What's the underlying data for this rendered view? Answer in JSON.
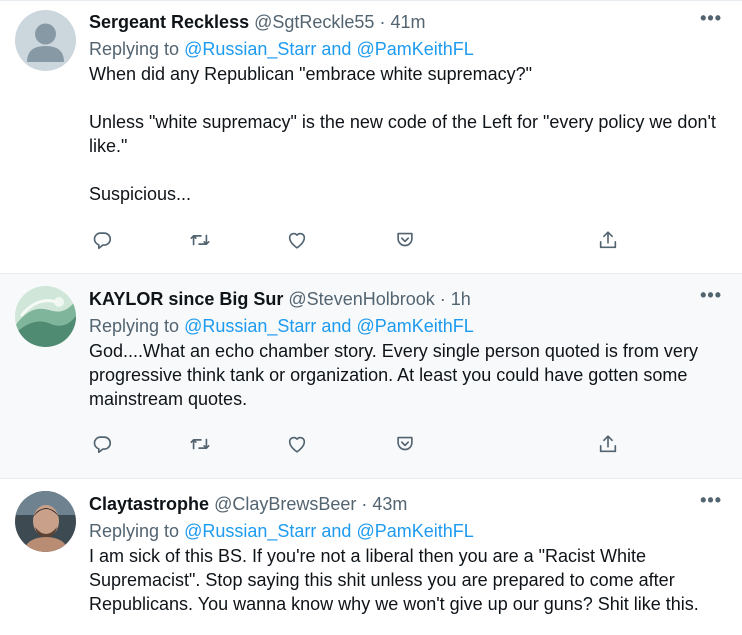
{
  "tweets": [
    {
      "name": "Sergeant Reckless",
      "handle": "@SgtReckle55",
      "dot": "·",
      "time": "41m",
      "more": "•••",
      "replying_prefix": "Replying to ",
      "reply_user_1": "@Russian_Starr",
      "reply_and": " and ",
      "reply_user_2": "@PamKeithFL",
      "paragraphs": [
        "When did any Republican \"embrace white supremacy?\"",
        "Unless \"white supremacy\" is the new code of the Left for \"every policy we don't like.\"",
        "Suspicious..."
      ],
      "avatar": "default-avatar"
    },
    {
      "name": "KAYLOR since Big Sur",
      "handle": "@StevenHolbrook",
      "dot": "·",
      "time": "1h",
      "more": "•••",
      "replying_prefix": "Replying to ",
      "reply_user_1": "@Russian_Starr",
      "reply_and": " and ",
      "reply_user_2": "@PamKeithFL",
      "paragraphs": [
        "God....What an echo chamber story. Every single person quoted is from very progressive think tank or organization. At least you could have gotten some mainstream quotes."
      ],
      "avatar": "wave-avatar"
    },
    {
      "name": "Claytastrophe",
      "handle": "@ClayBrewsBeer",
      "dot": "·",
      "time": "43m",
      "more": "•••",
      "replying_prefix": "Replying to ",
      "reply_user_1": "@Russian_Starr",
      "reply_and": " and ",
      "reply_user_2": "@PamKeithFL",
      "paragraphs": [
        "I am sick of this BS. If you're not a liberal then you are a \"Racist White Supremacist\". Stop saying this shit unless you are prepared to come after Republicans. You wanna know why we won't give up our guns? Shit like this."
      ],
      "avatar": "person-avatar"
    }
  ],
  "icons": [
    "reply-icon",
    "retweet-icon",
    "like-icon",
    "save-icon",
    "share-icon"
  ],
  "colors": {
    "link": "#1d9bf0",
    "secondary_text": "#536471",
    "primary_text": "#0f1419",
    "hover_background": "#f7f9fa",
    "border": "#e6ecf0"
  }
}
